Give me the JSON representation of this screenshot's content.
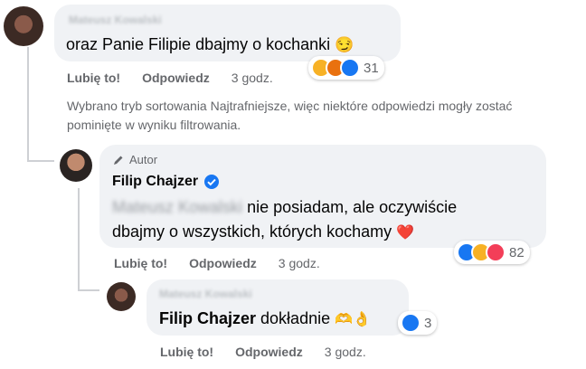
{
  "comment1": {
    "author": "Mateusz Kowalski",
    "text": "oraz Panie Filipie dbajmy o kochanki",
    "emoji": "😏",
    "like_label": "Lubię to!",
    "reply_label": "Odpowiedz",
    "time": "3 godz.",
    "reaction_count": "31",
    "reactions": [
      "haha",
      "angry",
      "like"
    ]
  },
  "sort_notice": {
    "line1": "Wybrano tryb sortowania Najtrafniejsze, więc niektóre odpowiedzi mogły zostać",
    "line2": "pominięte w wyniku filtrowania."
  },
  "reply1": {
    "badge": "Autor",
    "author": "Filip Chajzer",
    "mention": "Mateusz Kowalski",
    "text_line1": "nie posiadam, ale oczywiście",
    "text_line2": "dbajmy o wszystkich, których kochamy",
    "emoji": "❤️",
    "like_label": "Lubię to!",
    "reply_label": "Odpowiedz",
    "time": "3 godz.",
    "reaction_count": "82",
    "reactions": [
      "like",
      "haha",
      "love"
    ]
  },
  "reply2": {
    "author": "Mateusz Kowalski",
    "mention": "Filip Chajzer",
    "text": "dokładnie",
    "emoji": "🫶👌",
    "like_label": "Lubię to!",
    "reply_label": "Odpowiedz",
    "time": "3 godz.",
    "reaction_count": "3",
    "reactions": [
      "like"
    ]
  },
  "colors": {
    "like": "#1877f2",
    "haha": "#f7b125",
    "angry": "#e9710f",
    "love": "#f33e58",
    "verified": "#1877f2",
    "bubble": "#f0f2f5"
  }
}
